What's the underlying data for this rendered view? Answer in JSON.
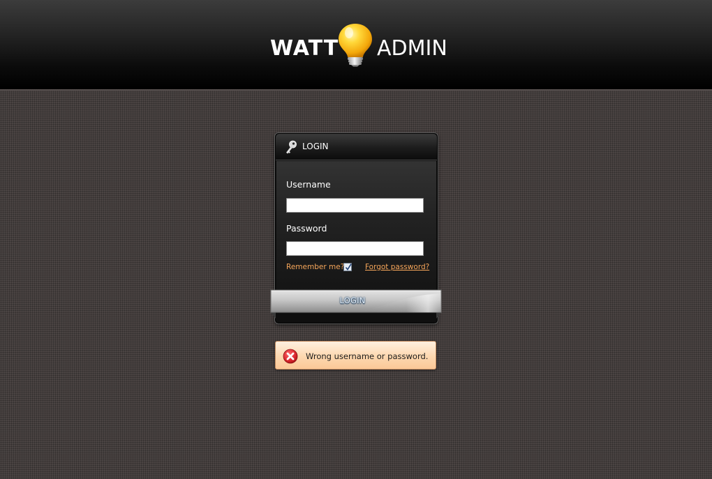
{
  "header": {
    "brand_left": "WATT",
    "brand_right": "ADMIN",
    "logo_icon": "lightbulb-icon"
  },
  "login_panel": {
    "title": "LOGIN",
    "title_icon": "key-icon",
    "username_label": "Username",
    "username_value": "",
    "password_label": "Password",
    "password_value": "",
    "remember_label": "Remember me?",
    "remember_checked": true,
    "forgot_link": "Forgot password?",
    "submit_label": "LOGIN"
  },
  "alert": {
    "type": "error",
    "icon": "error-x-icon",
    "message": "Wrong username or password."
  },
  "colors": {
    "background": "#4c4544",
    "header": "#0b0b0b",
    "link_orange": "#f6a65a",
    "alert_bg": "#fdd8b0",
    "alert_icon_red": "#d8242b"
  }
}
